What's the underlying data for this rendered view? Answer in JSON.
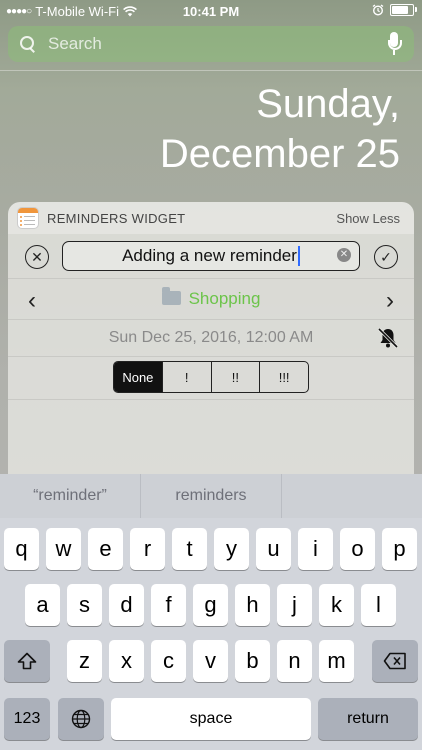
{
  "status_bar": {
    "carrier": "T-Mobile Wi-Fi",
    "time": "10:41 PM",
    "battery_level": 0.9
  },
  "search": {
    "placeholder": "Search"
  },
  "date": {
    "day": "Sunday,",
    "full": "December 25"
  },
  "widget": {
    "title": "REMINDERS WIDGET",
    "toggle_label": "Show Less",
    "input_value": "Adding a new reminder",
    "list_name": "Shopping",
    "list_color": "#6cc44a",
    "date_text": "Sun Dec 25, 2016, 12:00 AM",
    "priority_options": [
      "None",
      "!",
      "!!",
      "!!!"
    ],
    "selected_priority": "None"
  },
  "suggestions": [
    "“reminder”",
    "reminders",
    ""
  ],
  "keyboard": {
    "row1": [
      "q",
      "w",
      "e",
      "r",
      "t",
      "y",
      "u",
      "i",
      "o",
      "p"
    ],
    "row2": [
      "a",
      "s",
      "d",
      "f",
      "g",
      "h",
      "j",
      "k",
      "l"
    ],
    "row3": [
      "z",
      "x",
      "c",
      "v",
      "b",
      "n",
      "m"
    ],
    "numbers_label": "123",
    "space_label": "space",
    "return_label": "return"
  }
}
